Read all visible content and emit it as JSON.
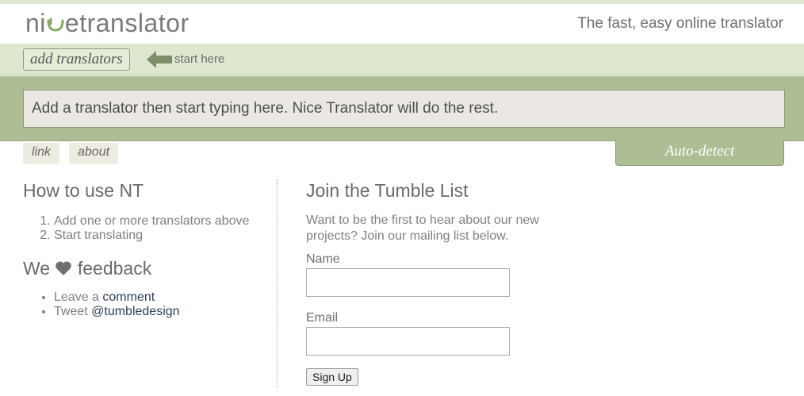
{
  "header": {
    "logo_prefix": "ni",
    "logo_suffix": "etranslator",
    "tagline": "The fast, easy online translator"
  },
  "toolbar": {
    "add_translators_label": "add translators",
    "start_here_label": "start here"
  },
  "editor": {
    "placeholder": "Add a translator then start typing here. Nice Translator will do the rest."
  },
  "tabs": {
    "link_label": "link",
    "about_label": "about",
    "auto_detect_label": "Auto-detect"
  },
  "how_to": {
    "title": "How to use NT",
    "steps": [
      "Add one or more translators above",
      "Start translating"
    ]
  },
  "feedback": {
    "title_prefix": "We",
    "title_suffix": "feedback",
    "items": [
      {
        "prefix": "Leave a",
        "link": "comment"
      },
      {
        "prefix": "Tweet",
        "link": "@tumbledesign"
      }
    ]
  },
  "tumble_list": {
    "title": "Join the Tumble List",
    "intro": "Want to be the first to hear about our new projects? Join our mailing list below.",
    "name_label": "Name",
    "email_label": "Email",
    "signup_label": "Sign Up"
  },
  "colors": {
    "accent_green": "#aebe94",
    "light_green": "#dde8cf",
    "link_color": "#2b3f5a"
  },
  "icons": [
    "smile-logo-icon",
    "arrow-left-icon",
    "heart-icon"
  ]
}
